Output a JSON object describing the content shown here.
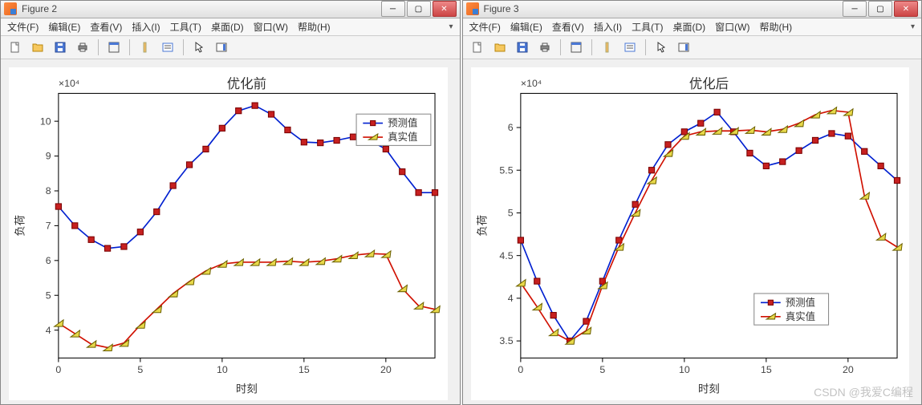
{
  "watermark": "CSDN @我爱C编程",
  "windows": [
    {
      "title": "Figure 2",
      "menus": [
        "文件(F)",
        "编辑(E)",
        "查看(V)",
        "插入(I)",
        "工具(T)",
        "桌面(D)",
        "窗口(W)",
        "帮助(H)"
      ],
      "chart": {
        "title": "优化前",
        "xlabel": "时刻",
        "ylabel": "负荷",
        "exponent": "×10⁴",
        "legend": [
          "预测值",
          "真实值"
        ],
        "xticks": [
          0,
          5,
          10,
          15,
          20
        ],
        "yticks": [
          4,
          5,
          6,
          7,
          8,
          9,
          10
        ],
        "xlim": [
          0,
          23
        ],
        "ylim": [
          3.2,
          10.8
        ]
      }
    },
    {
      "title": "Figure 3",
      "menus": [
        "文件(F)",
        "编辑(E)",
        "查看(V)",
        "插入(I)",
        "工具(T)",
        "桌面(D)",
        "窗口(W)",
        "帮助(H)"
      ],
      "chart": {
        "title": "优化后",
        "xlabel": "时刻",
        "ylabel": "负荷",
        "exponent": "×10⁴",
        "legend": [
          "预测值",
          "真实值"
        ],
        "xticks": [
          0,
          5,
          10,
          15,
          20
        ],
        "yticks": [
          3.5,
          4,
          4.5,
          5,
          5.5,
          6
        ],
        "xlim": [
          0,
          23
        ],
        "ylim": [
          3.3,
          6.4
        ]
      }
    }
  ],
  "chart_data": [
    {
      "type": "line",
      "title": "优化前",
      "xlabel": "时刻",
      "ylabel": "负荷 (×10^4)",
      "xlim": [
        0,
        23
      ],
      "ylim": [
        3.2,
        10.8
      ],
      "legend_position": "top-right",
      "x": [
        0,
        1,
        2,
        3,
        4,
        5,
        6,
        7,
        8,
        9,
        10,
        11,
        12,
        13,
        14,
        15,
        16,
        17,
        18,
        19,
        20,
        21,
        22,
        23
      ],
      "series": [
        {
          "name": "预测值",
          "marker": "square",
          "color": "#0020d0",
          "values": [
            7.55,
            7.0,
            6.6,
            6.35,
            6.4,
            6.82,
            7.4,
            8.15,
            8.75,
            9.2,
            9.8,
            10.3,
            10.45,
            10.2,
            9.75,
            9.4,
            9.38,
            9.45,
            9.55,
            9.45,
            9.2,
            8.55,
            7.95,
            7.95
          ]
        },
        {
          "name": "真实值",
          "marker": "triangle",
          "color": "#d01000",
          "values": [
            4.2,
            3.9,
            3.6,
            3.5,
            3.63,
            4.15,
            4.6,
            5.05,
            5.4,
            5.7,
            5.9,
            5.95,
            5.95,
            5.95,
            5.98,
            5.95,
            5.98,
            6.05,
            6.15,
            6.2,
            6.18,
            5.2,
            4.7,
            4.6
          ]
        }
      ]
    },
    {
      "type": "line",
      "title": "优化后",
      "xlabel": "时刻",
      "ylabel": "负荷 (×10^4)",
      "xlim": [
        0,
        23
      ],
      "ylim": [
        3.3,
        6.4
      ],
      "legend_position": "bottom-center-right",
      "x": [
        0,
        1,
        2,
        3,
        4,
        5,
        6,
        7,
        8,
        9,
        10,
        11,
        12,
        13,
        14,
        15,
        16,
        17,
        18,
        19,
        20,
        21,
        22,
        23
      ],
      "series": [
        {
          "name": "预测值",
          "marker": "square",
          "color": "#0020d0",
          "values": [
            4.68,
            4.2,
            3.8,
            3.5,
            3.73,
            4.2,
            4.68,
            5.1,
            5.5,
            5.8,
            5.95,
            6.05,
            6.18,
            5.95,
            5.7,
            5.55,
            5.6,
            5.73,
            5.85,
            5.93,
            5.9,
            5.72,
            5.55,
            5.38
          ]
        },
        {
          "name": "真实值",
          "marker": "triangle",
          "color": "#d01000",
          "values": [
            4.18,
            3.9,
            3.6,
            3.5,
            3.62,
            4.15,
            4.6,
            5.0,
            5.38,
            5.7,
            5.9,
            5.95,
            5.96,
            5.96,
            5.97,
            5.95,
            5.98,
            6.05,
            6.15,
            6.2,
            6.18,
            5.2,
            4.72,
            4.6
          ]
        }
      ]
    }
  ]
}
